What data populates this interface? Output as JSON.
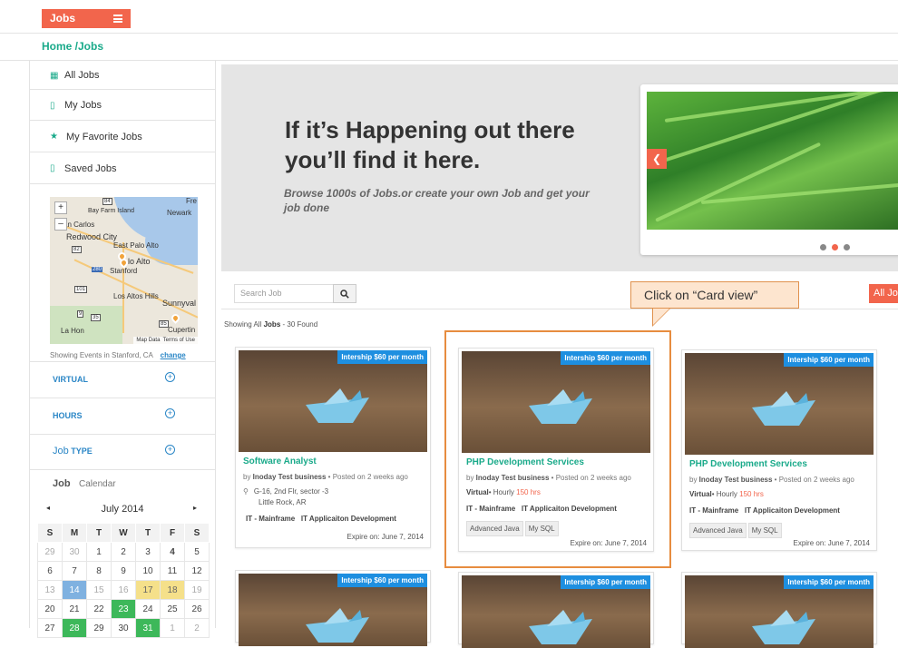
{
  "topbar": {
    "jobs_label": "Jobs"
  },
  "breadcrumb": "Home /Jobs",
  "sidebar": {
    "items": [
      {
        "label": "All Jobs",
        "icon": "grid-icon"
      },
      {
        "label": "My Jobs",
        "icon": "phone-icon"
      },
      {
        "label": "My Favorite Jobs",
        "icon": "star-icon"
      },
      {
        "label": "Saved Jobs",
        "icon": "phone-icon"
      }
    ],
    "map": {
      "labels": [
        "Fre",
        "Bay Farm Island",
        "Newark",
        "an Carlos",
        "Redwood City",
        "East Palo Alto",
        "lo Alto",
        "Stanford",
        "Los Altos Hills",
        "Sunnyval",
        "La Hon",
        "Cupertin",
        "280",
        "101",
        "84",
        "82",
        "35",
        "9",
        "85"
      ],
      "credit": [
        "Map Data",
        "Terms of Use"
      ],
      "zoom_in": "+",
      "zoom_out": "–"
    },
    "map_location": "Showing Events in Stanford, CA",
    "map_change": "change",
    "filters": [
      {
        "label": "VIRTUAL"
      },
      {
        "label": "HOURS"
      },
      {
        "label": "Job",
        "label2": "TYPE"
      }
    ],
    "calendar": {
      "title": "Job",
      "subtitle": "Calendar",
      "month": "July 2014",
      "prev": "◂",
      "next": "▸",
      "weekdays": [
        "S",
        "M",
        "T",
        "W",
        "T",
        "F",
        "S"
      ]
    }
  },
  "hero": {
    "headline": "If it’s Happening out there you’ll find it here.",
    "subtext": "Browse 1000s of Jobs.or create your own Job and get your job done",
    "prev_arrow": "❮"
  },
  "search": {
    "placeholder": "Search Job",
    "button_icon": "search-icon",
    "all_jobs_label": "All Jo"
  },
  "callout": "Click on “Card view”",
  "results": {
    "prefix": "Showing All",
    "type": "Jobs",
    "suffix": "- 30 Found"
  },
  "cards": [
    {
      "badge": "Intership $60 per month",
      "title": "Software Analyst",
      "by": "Inoday Test business",
      "posted": "Posted on 2 weeks ago",
      "address1": "G-16, 2nd Flr, sector -3",
      "address2": "Little Rock, AR",
      "categories": "IT - Mainframe   IT Applicaiton Development",
      "expire": "Expire on: June 7, 2014"
    },
    {
      "badge": "Intership $60 per month",
      "title": "PHP Development Services",
      "by": "Inoday Test business",
      "posted": "Posted on 2 weeks ago",
      "virtual": "Virtual",
      "hourly": "Hourly",
      "hours": "150 hrs",
      "categories": "IT - Mainframe   IT Applicaiton Development",
      "tags": [
        "Advanced Java",
        "My SQL"
      ],
      "expire": "Expire on: June 7, 2014"
    },
    {
      "badge": "Intership $60 per month",
      "title": "PHP Development Services",
      "by": "Inoday Test business",
      "posted": "Posted on 2 weeks ago",
      "virtual": "Virtual",
      "hourly": "Hourly",
      "hours": "150 hrs",
      "categories": "IT - Mainframe   IT Applicaiton Development",
      "tags": [
        "Advanced Java",
        "My SQL"
      ],
      "expire": "Expire on: June 7, 2014"
    },
    {
      "badge": "Intership $60 per month"
    },
    {
      "badge": "Intership $60 per month"
    },
    {
      "badge": "Intership $60 per month"
    }
  ],
  "colors": {
    "accent": "#f2654c",
    "green": "#1aaa8a",
    "blue": "#2a86c6",
    "badge": "#1e8fe0",
    "highlight": "#e78c3f"
  }
}
